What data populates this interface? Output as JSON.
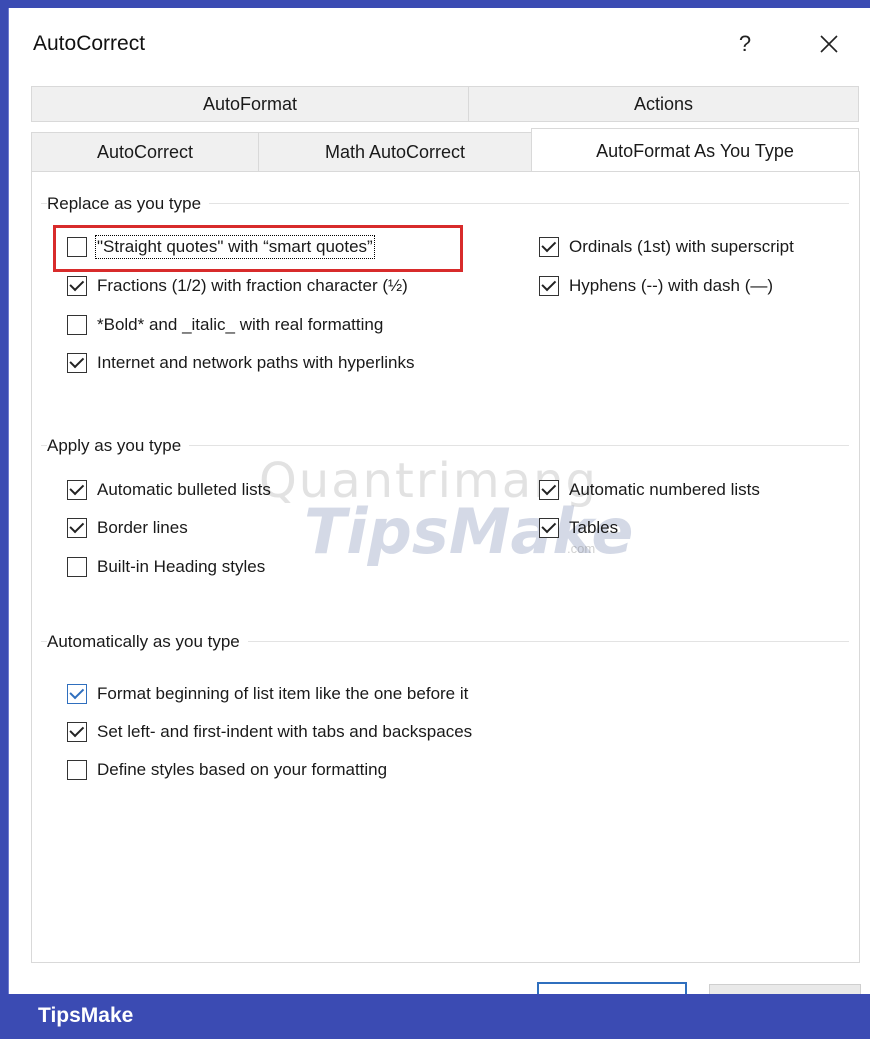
{
  "window": {
    "title": "AutoCorrect",
    "help_label": "?",
    "close_icon": "close-icon"
  },
  "tabs": {
    "row_top": [
      {
        "label": "AutoFormat"
      },
      {
        "label": "Actions"
      }
    ],
    "row_bottom": [
      {
        "label": "AutoCorrect"
      },
      {
        "label": "Math AutoCorrect"
      },
      {
        "label": "AutoFormat As You Type",
        "active": true
      }
    ]
  },
  "replace_group": {
    "label": "Replace as you type",
    "left": [
      {
        "label": "\"Straight quotes\" with “smart quotes”",
        "checked": false,
        "highlighted": true
      },
      {
        "label": "Fractions (1/2) with fraction character (½)",
        "checked": true
      },
      {
        "label": "*Bold* and _italic_ with real formatting",
        "checked": false
      },
      {
        "label": "Internet and network paths with hyperlinks",
        "checked": true
      }
    ],
    "right": [
      {
        "label": "Ordinals (1st) with superscript",
        "checked": true
      },
      {
        "label": "Hyphens (--) with dash (—)",
        "checked": true
      }
    ]
  },
  "apply_group": {
    "label": "Apply as you type",
    "left": [
      {
        "label": "Automatic bulleted lists",
        "checked": true
      },
      {
        "label": "Border lines",
        "checked": true
      },
      {
        "label": "Built-in Heading styles",
        "checked": false
      }
    ],
    "right": [
      {
        "label": "Automatic numbered lists",
        "checked": true
      },
      {
        "label": "Tables",
        "checked": true
      }
    ]
  },
  "auto_group": {
    "label": "Automatically as you type",
    "items": [
      {
        "label": "Format beginning of list item like the one before it",
        "checked": true
      },
      {
        "label": "Set left- and first-indent with tabs and backspaces",
        "checked": true
      },
      {
        "label": "Define styles based on your formatting",
        "checked": false
      }
    ]
  },
  "watermark": {
    "top": "Quantrimang",
    "bottom": "TipsMake",
    "suffix": ".com"
  },
  "footer": {
    "brand": "TipsMake"
  },
  "colors": {
    "accent": "#3b4bb3",
    "highlight": "#d82b2b",
    "focus_blue": "#2f6fbe"
  }
}
